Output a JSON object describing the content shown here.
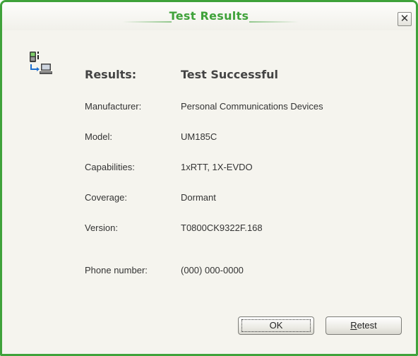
{
  "window": {
    "title": "Test Results",
    "close_glyph": "✕",
    "accent_color": "#3fa23a",
    "icon": "phone-to-computer-icon"
  },
  "results": {
    "heading_label": "Results:",
    "heading_value": "Test Successful"
  },
  "details": {
    "manufacturer": {
      "label": "Manufacturer:",
      "value": "Personal Communications Devices"
    },
    "model": {
      "label": "Model:",
      "value": "UM185C"
    },
    "capabilities": {
      "label": "Capabilities:",
      "value": "1xRTT, 1X-EVDO"
    },
    "coverage": {
      "label": "Coverage:",
      "value": "Dormant"
    },
    "version": {
      "label": "Version:",
      "value": "T0800CK9322F.168"
    },
    "phone_number": {
      "label": "Phone number:",
      "value": "(000) 000-0000"
    }
  },
  "buttons": {
    "ok_label": "OK",
    "retest_mnemonic": "R",
    "retest_rest": "etest"
  }
}
